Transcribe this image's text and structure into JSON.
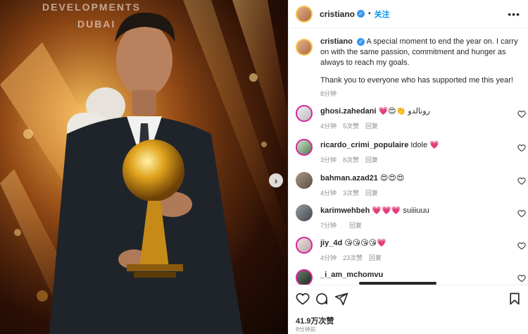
{
  "post": {
    "username": "cristiano",
    "follow_label": "关注",
    "dot": "•",
    "more_label": "•••",
    "verified_glyph": "✓"
  },
  "media": {
    "bg_text_1": "DEVELOPMENTS",
    "bg_text_2": "DUBAI",
    "next_glyph": "›"
  },
  "caption": {
    "username": "cristiano",
    "text": "A special moment to end the year on. I carry on with the same passion, commitment and hunger as always to reach my goals.",
    "text2": "Thank you to everyone who has supported me this year!",
    "time": "8分钟"
  },
  "comments": [
    {
      "username": "ghosi.zahedani",
      "text": "💗😍👏 رونالدو",
      "time": "4分钟",
      "likes": "5次赞",
      "reply": "回复"
    },
    {
      "username": "ricardo_crimi_populaire",
      "text": "Idole 💗",
      "time": "3分钟",
      "likes": "8次赞",
      "reply": "回复"
    },
    {
      "username": "bahman.azad21",
      "text": "😍😍😍",
      "time": "4分钟",
      "likes": "3次赞",
      "reply": "回复"
    },
    {
      "username": "karimwehbeh",
      "text": "💗💗💗 suiiiuuu",
      "time": "7分钟",
      "likes": "",
      "reply": "回复"
    },
    {
      "username": "jiy_4d",
      "text": "😘😘😘😘💗",
      "time": "4分钟",
      "likes": "23次赞",
      "reply": "回复"
    },
    {
      "username": "_i_am_mchomvu",
      "text": "",
      "time": "",
      "likes": "",
      "reply": ""
    }
  ],
  "footer": {
    "likes": "41.9万次赞",
    "date": "8分钟前"
  },
  "icons": {
    "like": "heart-icon",
    "comment": "comment-icon",
    "share": "share-icon",
    "save": "bookmark-icon"
  }
}
